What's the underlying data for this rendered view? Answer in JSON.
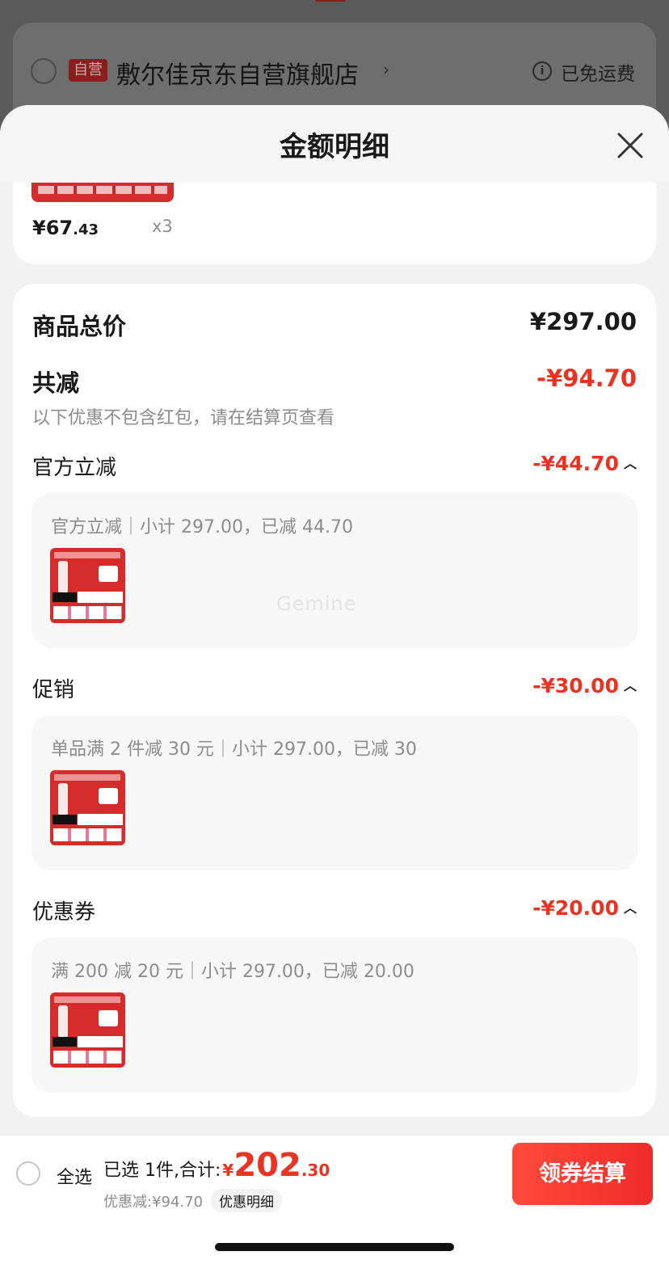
{
  "background": {
    "store_badge": "自营",
    "store_name": "敷尔佳京东自营旗舰店",
    "store_arrow": "›",
    "info_icon": "i",
    "shipping_note": "已免运费"
  },
  "sheet": {
    "title": "金额明细",
    "close_icon": "close-icon"
  },
  "item": {
    "price_symbol_int": "¥67",
    "price_dec": ".43",
    "quantity": "x3"
  },
  "summary": {
    "total_label": "商品总价",
    "total_value": "¥297.00",
    "reduce_label": "共减",
    "reduce_value": "-¥94.70",
    "reduce_note": "以下优惠不包含红包，请在结算页查看"
  },
  "sections": [
    {
      "label": "官方立减",
      "value": "-¥44.70",
      "detail": "官方立减｜小计 297.00，已减 44.70"
    },
    {
      "label": "促销",
      "value": "-¥30.00",
      "detail": "单品满 2 件减 30 元｜小计 297.00，已减 30"
    },
    {
      "label": "优惠券",
      "value": "-¥20.00",
      "detail": "满 200 减 20 元｜小计 297.00，已减 20.00"
    }
  ],
  "watermark": "Gemine",
  "bottom": {
    "select_all": "全选",
    "selected_text": "已选 1件,合计:",
    "total_symbol": "¥",
    "total_int": "202",
    "total_dec": ".30",
    "discount_text": "优惠减:¥94.70",
    "discount_detail_btn": "优惠明细",
    "checkout_btn": "领券结算"
  },
  "colors": {
    "accent_red": "#e93323",
    "overlay": "#5a5a5a"
  }
}
